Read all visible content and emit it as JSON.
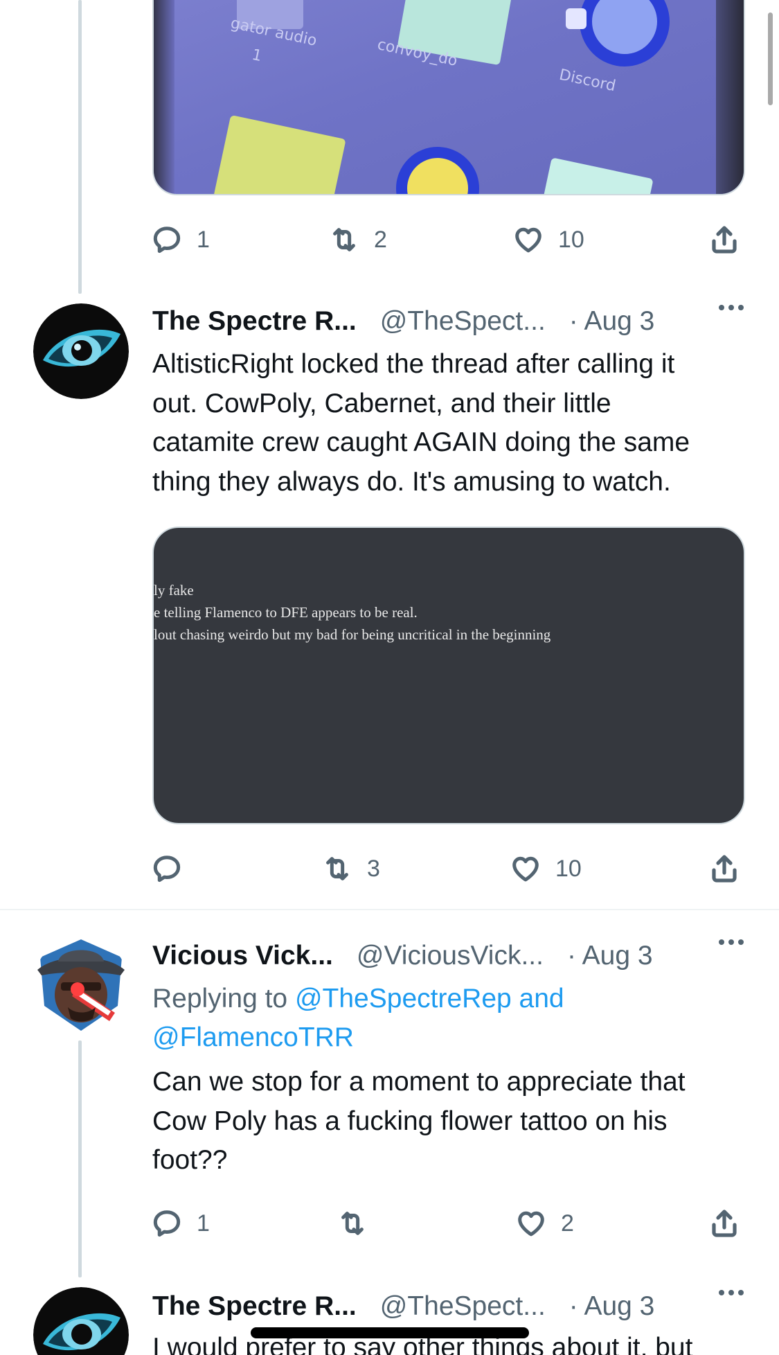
{
  "colors": {
    "text": "#0f1419",
    "secondary": "#536471",
    "link": "#1d9bf0",
    "line": "#cfd9de"
  },
  "tweets": [
    {
      "media_labels": [
        "gator audio",
        "1",
        "convoy_do",
        "Discord"
      ],
      "actions": {
        "reply": "1",
        "retweet": "2",
        "like": "10"
      }
    },
    {
      "name": "The Spectre R...",
      "handle": "@TheSpect...",
      "date": "· Aug 3",
      "text_lines": [
        "AltisticRight locked the thread after calling it",
        "out.  CowPoly, Cabernet, and their little",
        "catamite crew caught AGAIN doing the same",
        "thing they always do.  It's amusing to watch."
      ],
      "media_lines": [
        "ly fake",
        "e telling Flamenco to DFE appears to be real.",
        "lout chasing weirdo but my bad for being uncritical in the beginning"
      ],
      "actions": {
        "reply": "",
        "retweet": "3",
        "like": "10"
      }
    },
    {
      "name": "Vicious Vick...",
      "handle": "@ViciousVick...",
      "date": "· Aug 3",
      "replying_prefix": "Replying to ",
      "replying_link1": "@TheSpectreRep and",
      "replying_link2": "@FlamencoTRR",
      "text_lines": [
        "Can we stop for a moment to appreciate that",
        "Cow Poly has a fucking flower tattoo on his",
        "foot??"
      ],
      "actions": {
        "reply": "1",
        "retweet": "",
        "like": "2"
      }
    },
    {
      "name": "The Spectre R...",
      "handle": "@TheSpect...",
      "date": "· Aug 3",
      "text_lines": [
        "I would prefer to say other things about it, but"
      ]
    }
  ]
}
